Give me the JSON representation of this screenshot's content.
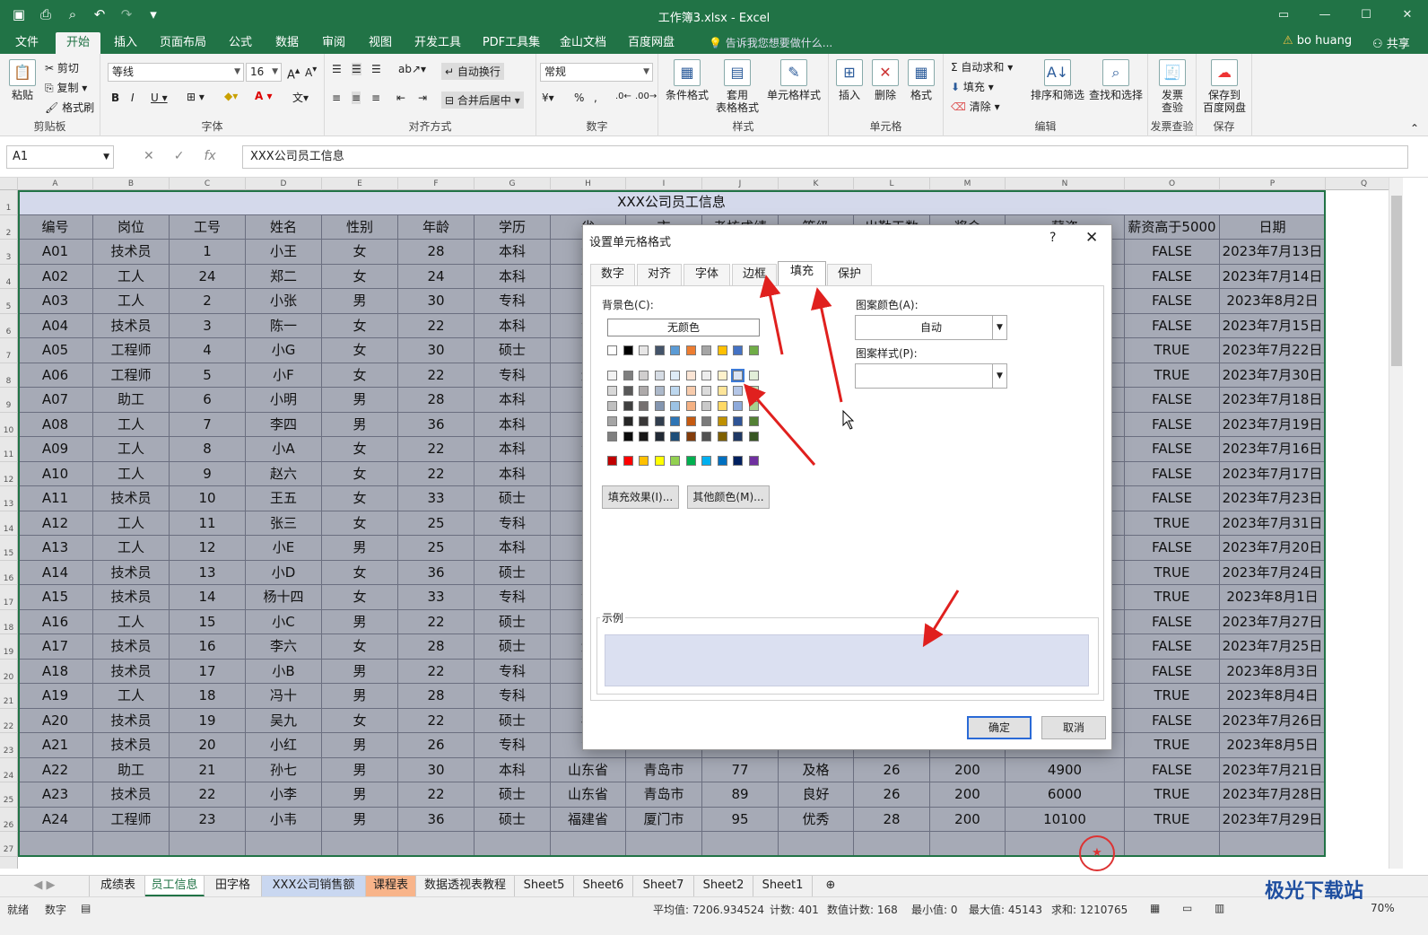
{
  "app": {
    "title": "工作簿3.xlsx - Excel"
  },
  "ribbon_tabs": [
    "文件",
    "开始",
    "插入",
    "页面布局",
    "公式",
    "数据",
    "审阅",
    "视图",
    "开发工具",
    "PDF工具集",
    "金山文档",
    "百度网盘"
  ],
  "tell_me": "告诉我您想要做什么...",
  "user": "bo huang",
  "share": "共享",
  "clipboard": {
    "paste": "粘贴",
    "cut": "剪切",
    "copy": "复制",
    "painter": "格式刷",
    "label": "剪贴板"
  },
  "font": {
    "name": "等线",
    "size": "16",
    "label": "字体"
  },
  "align": {
    "wrap": "自动换行",
    "merge": "合并后居中",
    "label": "对齐方式"
  },
  "number": {
    "format": "常规",
    "label": "数字"
  },
  "styles": {
    "cond": "条件格式",
    "table": "套用\n表格格式",
    "cell": "单元格样式",
    "label": "样式"
  },
  "cells": {
    "insert": "插入",
    "delete": "删除",
    "format": "格式",
    "label": "单元格"
  },
  "editing": {
    "autosum": "自动求和",
    "fill": "填充",
    "clear": "清除",
    "sort": "排序和筛选",
    "find": "查找和选择",
    "label": "编辑"
  },
  "invoice": {
    "btn": "发票\n查验",
    "label": "发票查验"
  },
  "save": {
    "btn": "保存到\n百度网盘",
    "label": "保存"
  },
  "formula_bar": {
    "name_box": "A1",
    "content": "XXX公司员工信息"
  },
  "columns": [
    "A",
    "B",
    "C",
    "D",
    "E",
    "F",
    "G",
    "H",
    "I",
    "J",
    "K",
    "L",
    "M",
    "N",
    "O",
    "P",
    "Q"
  ],
  "sheet_title": "XXX公司员工信息",
  "header_row": [
    "编号",
    "岗位",
    "工号",
    "姓名",
    "性别",
    "年龄",
    "学历",
    "省",
    "市",
    "考核成绩",
    "等级",
    "出勤天数",
    "奖金",
    "薪资",
    "薪资高于5000",
    "日期"
  ],
  "rows": [
    [
      "A01",
      "技术员",
      "1",
      "小王",
      "女",
      "28",
      "本科",
      "湖",
      "",
      "",
      "",
      "",
      "",
      "",
      "FALSE",
      "2023年7月13日"
    ],
    [
      "A02",
      "工人",
      "24",
      "郑二",
      "女",
      "24",
      "本科",
      "湖",
      "",
      "",
      "",
      "",
      "",
      "",
      "FALSE",
      "2023年7月14日"
    ],
    [
      "A03",
      "工人",
      "2",
      "小张",
      "男",
      "30",
      "专科",
      "山",
      "",
      "",
      "",
      "",
      "",
      "",
      "FALSE",
      "2023年8月2日"
    ],
    [
      "A04",
      "技术员",
      "3",
      "陈一",
      "女",
      "22",
      "本科",
      "湖",
      "",
      "",
      "",
      "",
      "",
      "",
      "FALSE",
      "2023年7月15日"
    ],
    [
      "A05",
      "工程师",
      "4",
      "小G",
      "女",
      "30",
      "硕士",
      "吉",
      "",
      "",
      "",
      "",
      "",
      "",
      "TRUE",
      "2023年7月22日"
    ],
    [
      "A06",
      "工程师",
      "5",
      "小F",
      "女",
      "22",
      "专科",
      "辽",
      "",
      "",
      "",
      "",
      "",
      "",
      "TRUE",
      "2023年7月30日"
    ],
    [
      "A07",
      "助工",
      "6",
      "小明",
      "男",
      "28",
      "本科",
      "江",
      "",
      "",
      "",
      "",
      "",
      "",
      "FALSE",
      "2023年7月18日"
    ],
    [
      "A08",
      "工人",
      "7",
      "李四",
      "男",
      "36",
      "本科",
      "湖",
      "",
      "",
      "",
      "",
      "",
      "",
      "FALSE",
      "2023年7月19日"
    ],
    [
      "A09",
      "工人",
      "8",
      "小A",
      "女",
      "22",
      "本科",
      "湖",
      "",
      "",
      "",
      "",
      "",
      "",
      "FALSE",
      "2023年7月16日"
    ],
    [
      "A10",
      "工人",
      "9",
      "赵六",
      "女",
      "22",
      "本科",
      "吉",
      "",
      "",
      "",
      "",
      "",
      "",
      "FALSE",
      "2023年7月17日"
    ],
    [
      "A11",
      "技术员",
      "10",
      "王五",
      "女",
      "33",
      "硕士",
      "四",
      "",
      "",
      "",
      "",
      "",
      "",
      "FALSE",
      "2023年7月23日"
    ],
    [
      "A12",
      "工人",
      "11",
      "张三",
      "女",
      "25",
      "专科",
      "吉",
      "",
      "",
      "",
      "",
      "",
      "",
      "TRUE",
      "2023年7月31日"
    ],
    [
      "A13",
      "工人",
      "12",
      "小E",
      "男",
      "25",
      "本科",
      "吉",
      "",
      "",
      "",
      "",
      "",
      "",
      "FALSE",
      "2023年7月20日"
    ],
    [
      "A14",
      "技术员",
      "13",
      "小D",
      "女",
      "36",
      "硕士",
      "四",
      "",
      "",
      "",
      "",
      "",
      "",
      "TRUE",
      "2023年7月24日"
    ],
    [
      "A15",
      "技术员",
      "14",
      "杨十四",
      "女",
      "33",
      "专科",
      "湖",
      "",
      "",
      "",
      "",
      "",
      "",
      "TRUE",
      "2023年8月1日"
    ],
    [
      "A16",
      "工人",
      "15",
      "小C",
      "男",
      "22",
      "硕士",
      "湖",
      "",
      "",
      "",
      "",
      "",
      "",
      "FALSE",
      "2023年7月27日"
    ],
    [
      "A17",
      "技术员",
      "16",
      "李六",
      "女",
      "28",
      "硕士",
      "辽",
      "",
      "",
      "",
      "",
      "",
      "",
      "FALSE",
      "2023年7月25日"
    ],
    [
      "A18",
      "技术员",
      "17",
      "小B",
      "男",
      "22",
      "专科",
      "江",
      "",
      "",
      "",
      "",
      "",
      "",
      "FALSE",
      "2023年8月3日"
    ],
    [
      "A19",
      "工人",
      "18",
      "冯十",
      "男",
      "28",
      "专科",
      "四",
      "",
      "",
      "",
      "",
      "",
      "",
      "TRUE",
      "2023年8月4日"
    ],
    [
      "A20",
      "技术员",
      "19",
      "吴九",
      "女",
      "22",
      "硕士",
      "福",
      "",
      "",
      "",
      "",
      "",
      "",
      "FALSE",
      "2023年7月26日"
    ],
    [
      "A21",
      "技术员",
      "20",
      "小红",
      "男",
      "26",
      "专科",
      "江",
      "",
      "",
      "",
      "",
      "",
      "",
      "TRUE",
      "2023年8月5日"
    ],
    [
      "A22",
      "助工",
      "21",
      "孙七",
      "男",
      "30",
      "本科",
      "山东省",
      "青岛市",
      "77",
      "及格",
      "26",
      "200",
      "4900",
      "FALSE",
      "2023年7月21日"
    ],
    [
      "A23",
      "技术员",
      "22",
      "小李",
      "男",
      "22",
      "硕士",
      "山东省",
      "青岛市",
      "89",
      "良好",
      "26",
      "200",
      "6000",
      "TRUE",
      "2023年7月28日"
    ],
    [
      "A24",
      "工程师",
      "23",
      "小韦",
      "男",
      "36",
      "硕士",
      "福建省",
      "厦门市",
      "95",
      "优秀",
      "28",
      "200",
      "10100",
      "TRUE",
      "2023年7月29日"
    ]
  ],
  "dialog": {
    "title": "设置单元格格式",
    "help": "?",
    "close": "✕",
    "tabs": [
      "数字",
      "对齐",
      "字体",
      "边框",
      "填充",
      "保护"
    ],
    "bg_label": "背景色(C):",
    "no_color": "无颜色",
    "pattern_color_label": "图案颜色(A):",
    "pattern_color_value": "自动",
    "pattern_style_label": "图案样式(P):",
    "fill_effects": "填充效果(I)...",
    "more_colors": "其他颜色(M)...",
    "sample_label": "示例",
    "ok": "确定",
    "cancel": "取消",
    "sample_color": "#dbe0f1"
  },
  "sheets": [
    "成绩表",
    "员工信息",
    "田字格",
    "XXX公司销售额",
    "课程表",
    "数据透视表教程",
    "Sheet5",
    "Sheet6",
    "Sheet7",
    "Sheet2",
    "Sheet1"
  ],
  "status": {
    "ready": "就绪",
    "num": "数字",
    "avg": "平均值: 7206.934524",
    "count": "计数: 401",
    "numcount": "数值计数: 168",
    "min": "最小值: 0",
    "max": "最大值: 45143",
    "sum": "求和: 1210765",
    "zoom": "70%"
  },
  "watermark": "极光下载站"
}
